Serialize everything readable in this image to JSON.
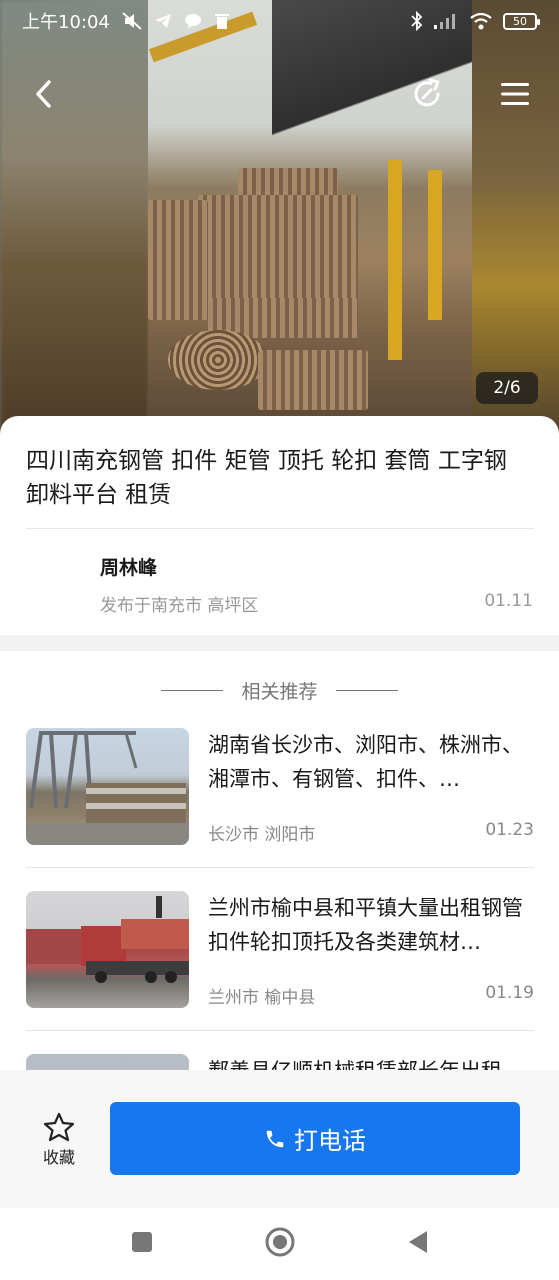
{
  "status_bar": {
    "time": "上午10:04",
    "battery": "50"
  },
  "gallery": {
    "counter": "2/6"
  },
  "listing": {
    "title": "四川南充钢管 扣件 矩管 顶托 轮扣 套筒 工字钢 卸料平台 租赁",
    "author": "周林峰",
    "location": "发布于南充市 高坪区",
    "date": "01.11"
  },
  "recommendations": {
    "heading": "相关推荐",
    "items": [
      {
        "title": "湖南省长沙市、浏阳市、株洲市、湘潭市、有钢管、扣件、…",
        "location": "长沙市 浏阳市",
        "date": "01.23"
      },
      {
        "title": "兰州市榆中县和平镇大量出租钢管扣件轮扣顶托及各类建筑材…",
        "location": "兰州市 榆中县",
        "date": "01.19"
      },
      {
        "title": "鄯善县亿顺机械租赁部长年出租"
      }
    ]
  },
  "action_bar": {
    "favorite_label": "收藏",
    "call_label": "打电话"
  },
  "colors": {
    "primary": "#1677ee"
  }
}
